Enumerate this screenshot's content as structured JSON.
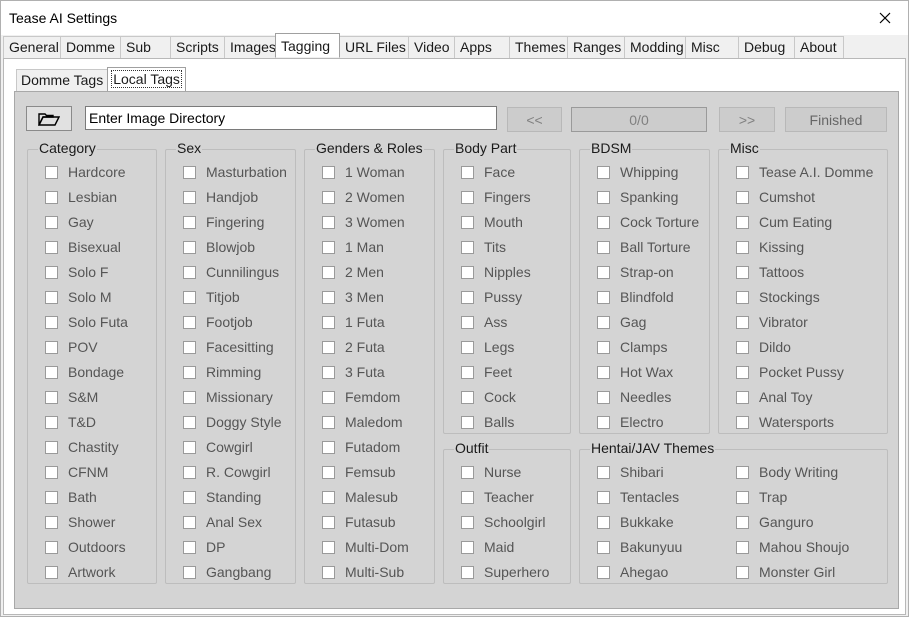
{
  "window": {
    "title": "Tease AI Settings"
  },
  "main_tabs": [
    "General",
    "Domme",
    "Sub",
    "Scripts",
    "Images",
    "Tagging",
    "URL Files",
    "Video",
    "Apps",
    "Themes",
    "Ranges",
    "Modding",
    "Misc",
    "Debug",
    "About"
  ],
  "main_tab_active": "Tagging",
  "sub_tabs": [
    "Domme Tags",
    "Local Tags"
  ],
  "sub_tab_active": "Local Tags",
  "toolbar": {
    "directory_value": "Enter Image Directory",
    "prev_label": "<<",
    "counter": "0/0",
    "next_label": ">>",
    "finished_label": "Finished"
  },
  "groups": {
    "category": {
      "title": "Category",
      "items": [
        "Hardcore",
        "Lesbian",
        "Gay",
        "Bisexual",
        "Solo F",
        "Solo M",
        "Solo Futa",
        "POV",
        "Bondage",
        "S&M",
        "T&D",
        "Chastity",
        "CFNM",
        "Bath",
        "Shower",
        "Outdoors",
        "Artwork"
      ]
    },
    "sex": {
      "title": "Sex",
      "items": [
        "Masturbation",
        "Handjob",
        "Fingering",
        "Blowjob",
        "Cunnilingus",
        "Titjob",
        "Footjob",
        "Facesitting",
        "Rimming",
        "Missionary",
        "Doggy Style",
        "Cowgirl",
        "R. Cowgirl",
        "Standing",
        "Anal Sex",
        "DP",
        "Gangbang"
      ]
    },
    "genders": {
      "title": "Genders & Roles",
      "items": [
        "1 Woman",
        "2 Women",
        "3 Women",
        "1 Man",
        "2 Men",
        "3 Men",
        "1 Futa",
        "2 Futa",
        "3 Futa",
        "Femdom",
        "Maledom",
        "Futadom",
        "Femsub",
        "Malesub",
        "Futasub",
        "Multi-Dom",
        "Multi-Sub"
      ]
    },
    "body": {
      "title": "Body Part",
      "items": [
        "Face",
        "Fingers",
        "Mouth",
        "Tits",
        "Nipples",
        "Pussy",
        "Ass",
        "Legs",
        "Feet",
        "Cock",
        "Balls"
      ]
    },
    "outfit": {
      "title": "Outfit",
      "items": [
        "Nurse",
        "Teacher",
        "Schoolgirl",
        "Maid",
        "Superhero"
      ]
    },
    "bdsm": {
      "title": "BDSM",
      "items": [
        "Whipping",
        "Spanking",
        "Cock Torture",
        "Ball Torture",
        "Strap-on",
        "Blindfold",
        "Gag",
        "Clamps",
        "Hot Wax",
        "Needles",
        "Electro"
      ]
    },
    "misc": {
      "title": "Misc",
      "items": [
        "Tease A.I. Domme",
        "Cumshot",
        "Cum Eating",
        "Kissing",
        "Tattoos",
        "Stockings",
        "Vibrator",
        "Dildo",
        "Pocket Pussy",
        "Anal Toy",
        "Watersports"
      ]
    },
    "hentai": {
      "title": "Hentai/JAV Themes",
      "items": [
        "Shibari",
        "Tentacles",
        "Bukkake",
        "Bakunyuu",
        "Ahegao",
        "Body Writing",
        "Trap",
        "Ganguro",
        "Mahou Shoujo",
        "Monster Girl"
      ]
    }
  }
}
